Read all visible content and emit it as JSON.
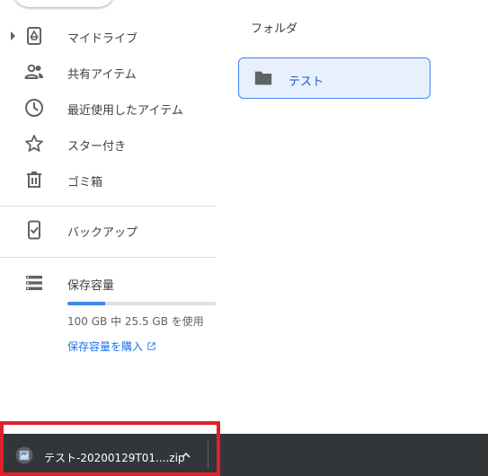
{
  "sidebar": {
    "items": [
      {
        "label": "マイドライブ",
        "icon": "drive-icon"
      },
      {
        "label": "共有アイテム",
        "icon": "people-icon"
      },
      {
        "label": "最近使用したアイテム",
        "icon": "clock-icon"
      },
      {
        "label": "スター付き",
        "icon": "star-icon"
      },
      {
        "label": "ゴミ箱",
        "icon": "trash-icon"
      },
      {
        "label": "バックアップ",
        "icon": "backup-icon"
      }
    ],
    "storage": {
      "label": "保存容量",
      "icon": "storage-icon",
      "used_fraction": 0.255,
      "usage_text": "100 GB 中 25.5 GB を使用",
      "buy_label": "保存容量を購入"
    }
  },
  "main": {
    "section_title": "フォルダ",
    "folders": [
      {
        "name": "テスト",
        "icon": "folder-icon"
      }
    ]
  },
  "download_bar": {
    "file_name": "テスト-20200129T01....zip",
    "file_icon": "zip-file-icon"
  },
  "colors": {
    "accent": "#1a73e8",
    "selected_bg": "#e8f0fe",
    "download_bar_bg": "#323639",
    "highlight": "#e0202a"
  }
}
